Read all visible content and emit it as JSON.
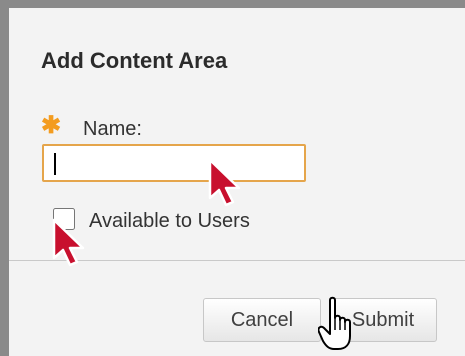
{
  "dialog": {
    "title": "Add Content Area",
    "required_marker": "✱",
    "name_label": "Name:",
    "name_value": "",
    "available_label": "Available to Users",
    "available_checked": false,
    "cancel_label": "Cancel",
    "submit_label": "Submit"
  },
  "colors": {
    "accent": "#f39c1f",
    "input_border": "#e5a54b",
    "pointer_red": "#c8102e"
  },
  "icons": [
    "arrow-pointer-icon",
    "hand-pointer-icon"
  ]
}
